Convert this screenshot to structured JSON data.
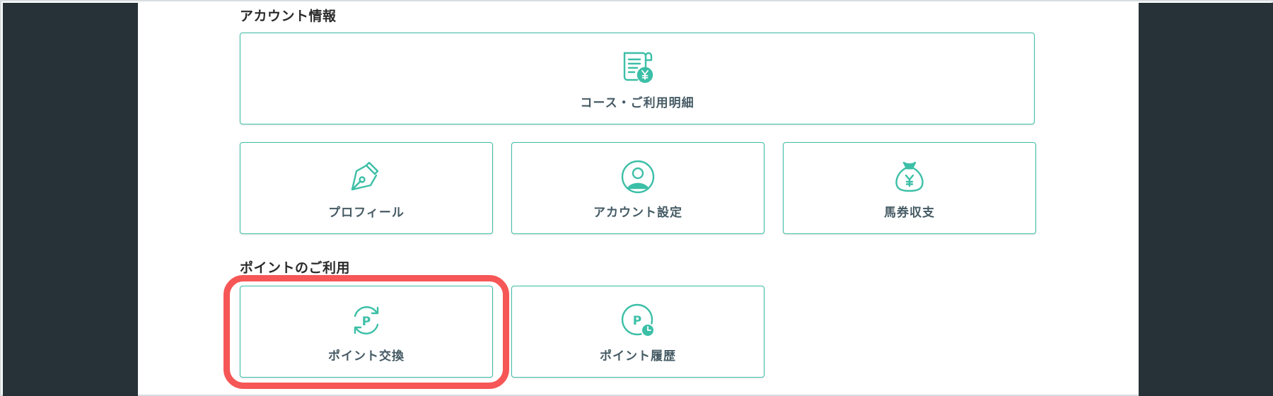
{
  "account_section": {
    "title": "アカウント情報",
    "course_card": {
      "label": "コース・ご利用明細",
      "icon": "receipt-yen-icon"
    },
    "profile_card": {
      "label": "プロフィール",
      "icon": "pen-nib-icon"
    },
    "account_settings_card": {
      "label": "アカウント設定",
      "icon": "user-circle-icon"
    },
    "betting_card": {
      "label": "馬券収支",
      "icon": "money-bag-yen-icon"
    }
  },
  "points_section": {
    "title": "ポイントのご利用",
    "exchange_card": {
      "label": "ポイント交換",
      "icon": "point-exchange-icon"
    },
    "history_card": {
      "label": "ポイント履歴",
      "icon": "point-history-icon"
    }
  },
  "colors": {
    "accent": "#3cbfa7",
    "side_panel": "#263238",
    "highlight": "#f65656",
    "label_text": "#455a64"
  }
}
